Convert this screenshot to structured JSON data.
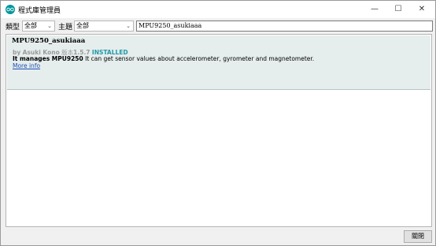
{
  "window": {
    "title": "程式庫管理員",
    "minimize": "—",
    "maximize": "☐",
    "close": "✕"
  },
  "filters": {
    "type_label": "類型",
    "type_value": "全部",
    "topic_label": "主題",
    "topic_value": "全部",
    "search_value": "MPU9250_asukiaaa"
  },
  "library": {
    "name": "MPU9250_asukiaaa",
    "by": "by",
    "author": "Asuki Kono",
    "version_label": "版本",
    "version": "1.5.7",
    "status": "INSTALLED",
    "desc_bold": "It manages MPU9250",
    "desc": "It can get sensor values about accelerometer, gyrometer and magnetometer.",
    "more_info": "More info"
  },
  "footer": {
    "close_label": "關閉"
  },
  "colors": {
    "accent": "#00979c",
    "installed": "#1f9aa6",
    "link": "#1a4fb3",
    "item_bg": "#e6eded"
  }
}
